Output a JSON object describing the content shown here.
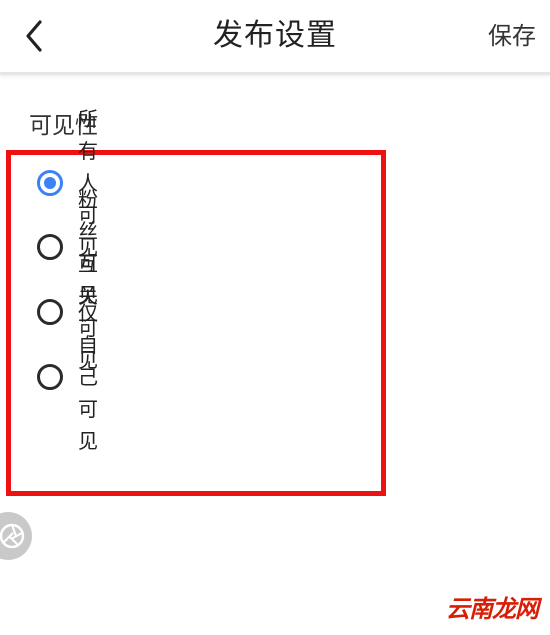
{
  "header": {
    "title": "发布设置",
    "save_label": "保存",
    "back_icon": "chevron-left-icon"
  },
  "visibility": {
    "label": "可见性",
    "selected": "所有人可见",
    "options": [
      {
        "label": "所有人可见",
        "checked": true
      },
      {
        "label": "粉丝可见",
        "checked": false
      },
      {
        "label": "互关可见",
        "checked": false
      },
      {
        "label": "仅自己可见",
        "checked": false
      }
    ]
  },
  "float_button": {
    "icon": "aperture-icon"
  },
  "watermark": {
    "text": "云南龙网"
  },
  "colors": {
    "accent": "#3b82f6",
    "highlight_border": "#ee1111",
    "watermark": "#d81e06"
  }
}
